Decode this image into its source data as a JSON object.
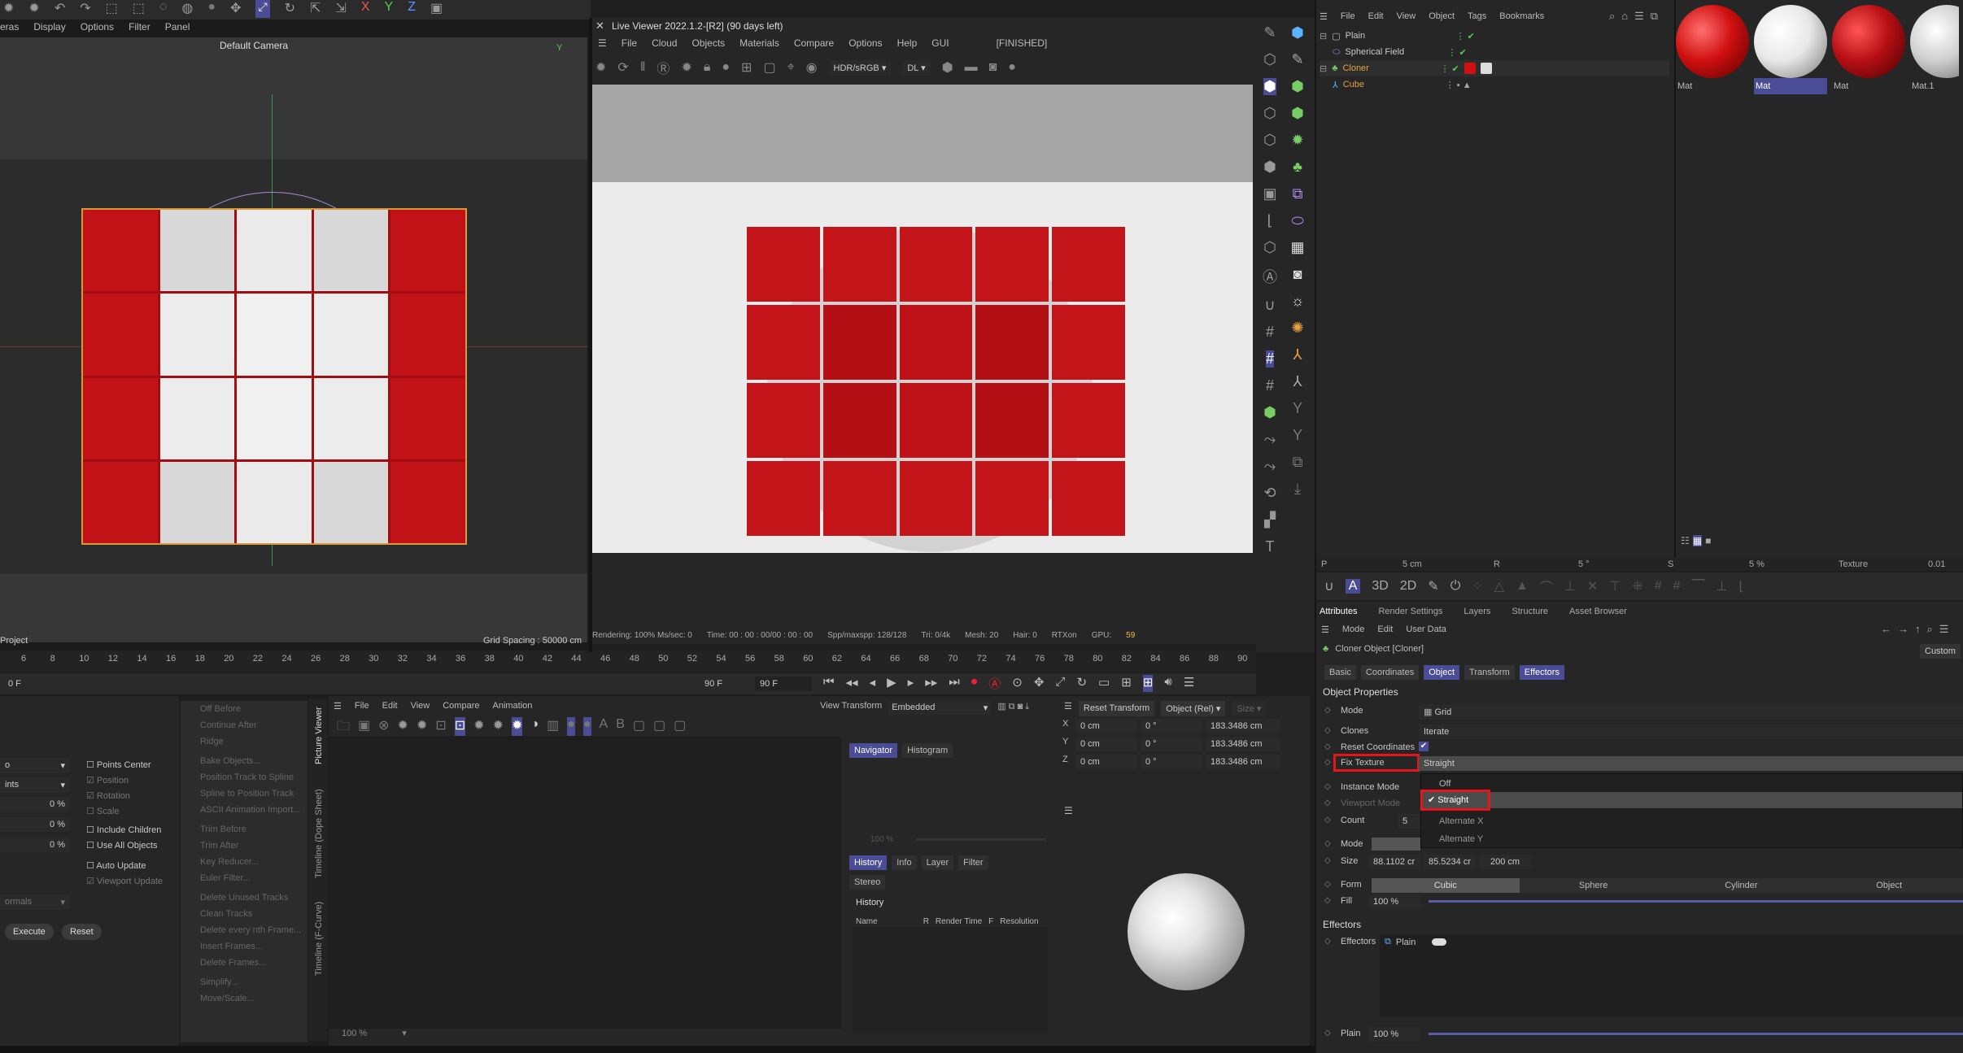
{
  "left_view": {
    "menu": [
      "eras",
      "Display",
      "Options",
      "Filter",
      "Panel"
    ],
    "camera": "Default Camera",
    "project": "Project",
    "grid_spacing": "Grid Spacing : 50000 cm"
  },
  "live_viewer": {
    "title": "Live Viewer 2022.1.2-[R2] (90 days left)",
    "menu": [
      "File",
      "Cloud",
      "Objects",
      "Materials",
      "Compare",
      "Options",
      "Help",
      "GUI"
    ],
    "status": "[FINISHED]",
    "color_mode": "HDR/sRGB",
    "dl": "DL",
    "status_bar": [
      "Rendering: 100% Ms/sec: 0",
      "Time: 00 : 00 : 00/00 : 00 : 00",
      "Spp/maxspp: 128/128",
      "Tri: 0/4k",
      "Mesh: 20",
      "Hair: 0",
      "RTXon",
      "GPU:",
      "59"
    ]
  },
  "timeline": {
    "ticks": [
      "6",
      "8",
      "10",
      "12",
      "14",
      "16",
      "18",
      "20",
      "22",
      "24",
      "26",
      "28",
      "30",
      "32",
      "34",
      "36",
      "38",
      "40",
      "42",
      "44",
      "46",
      "48",
      "50",
      "52",
      "54",
      "56",
      "58",
      "60",
      "62",
      "64",
      "66",
      "68",
      "70",
      "72",
      "74",
      "76",
      "78",
      "80",
      "82",
      "84",
      "86",
      "88",
      "90"
    ],
    "current": "0 F",
    "end": "90 F",
    "end2": "90 F"
  },
  "objects": {
    "menu": [
      "File",
      "Edit",
      "View",
      "Object",
      "Tags",
      "Bookmarks"
    ],
    "items": [
      {
        "name": "Plain",
        "color": "#c8c8c8"
      },
      {
        "name": "Spherical Field",
        "color": "#c8c8c8"
      },
      {
        "name": "Cloner",
        "color": "#e6a23c"
      },
      {
        "name": "Cube",
        "color": "#e6a23c"
      }
    ]
  },
  "materials": [
    {
      "label": "Mat",
      "color": "#d01010"
    },
    {
      "label": "Mat",
      "color": "#e8e8e8"
    },
    {
      "label": "Mat",
      "color": "#b81015"
    },
    {
      "label": "Mat.1",
      "color": "#cfcfcf"
    }
  ],
  "coords_strip": {
    "p": "P",
    "p_val": "5 cm",
    "r": "R",
    "r_val": "5 °",
    "s": "S",
    "s_val": "5 %",
    "texture": "Texture",
    "texture_val": "0.01"
  },
  "attributes": {
    "tabs": [
      "Attributes",
      "Render Settings",
      "Layers",
      "Structure",
      "Asset Browser"
    ],
    "menu": [
      "Mode",
      "Edit",
      "User Data"
    ],
    "title": "Cloner Object [Cloner]",
    "custom": "Custom",
    "subtabs": [
      "Basic",
      "Coordinates",
      "Object",
      "Transform",
      "Effectors"
    ],
    "section": "Object Properties",
    "mode_label": "Mode",
    "mode_val": "Grid",
    "clones_label": "Clones",
    "clones_val": "Iterate",
    "reset_coords_label": "Reset Coordinates",
    "fix_texture_label": "Fix Texture",
    "fix_texture_val": "Straight",
    "instance_mode_label": "Instance Mode",
    "viewport_mode_label": "Viewport Mode",
    "count_label": "Count",
    "count_val": "5",
    "mode2_label": "Mode",
    "size_label": "Size",
    "size_vals": [
      "88.1102 cr",
      "85.5234 cr",
      "200 cm"
    ],
    "form_label": "Form",
    "forms": [
      "Cubic",
      "Sphere",
      "Cylinder",
      "Object"
    ],
    "fill_label": "Fill",
    "fill_val": "100 %",
    "dropdown": [
      "Off",
      "Straight",
      "Alternate X",
      "Alternate Y"
    ],
    "effectors_section": "Effectors",
    "effectors_label": "Effectors",
    "effector_item": "Plain",
    "plain_label": "Plain",
    "plain_val": "100 %"
  },
  "bottom_left": {
    "points_center": "Points Center",
    "position": "Position",
    "rotation": "Rotation",
    "scale": "Scale",
    "pcts": [
      "0 %",
      "0 %",
      "0 %"
    ],
    "include_children": "Include Children",
    "use_all_objects": "Use All Objects",
    "auto_update": "Auto Update",
    "viewport_update": "Viewport Update",
    "execute": "Execute",
    "reset": "Reset",
    "dd1": "o",
    "dd2": "ints",
    "dd3": "ormals"
  },
  "menu_list": [
    "Off Before",
    "Continue After",
    "Ridge",
    "Bake Objects...",
    "Position Track to Spline",
    "Spline to Position Track",
    "ASCII Animation Import...",
    "Trim Before",
    "Trim After",
    "Key Reducer...",
    "Euler Filter...",
    "Delete Unused Tracks",
    "Clean Tracks",
    "Delete every nth Frame...",
    "Insert Frames...",
    "Delete Frames...",
    "Simplify...",
    "Move/Scale..."
  ],
  "side_tabs": [
    "Picture Viewer",
    "Timeline (Dope Sheet)",
    "Timeline (F-Curve)"
  ],
  "picture_viewer": {
    "menu": [
      "File",
      "Edit",
      "View",
      "Compare",
      "Animation"
    ],
    "view_transform": "View Transform",
    "embedded": "Embedded",
    "tabs": [
      "Navigator",
      "Histogram"
    ],
    "zoom": "100 %",
    "tabs2": [
      "History",
      "Info",
      "Layer",
      "Filter"
    ],
    "stereo": "Stereo",
    "history": "History",
    "cols": [
      "Name",
      "R",
      "Render Time",
      "F",
      "Resolution"
    ],
    "zoom2": "100 %"
  },
  "coord_manager": {
    "reset": "Reset Transform",
    "mode": "Object (Rel)",
    "size": "Size",
    "rows": [
      {
        "axis": "X",
        "pos": "0 cm",
        "rot": "0 °",
        "size": "183.3486 cm"
      },
      {
        "axis": "Y",
        "pos": "0 cm",
        "rot": "0 °",
        "size": "183.3486 cm"
      },
      {
        "axis": "Z",
        "pos": "0 cm",
        "rot": "0 °",
        "size": "183.3486 cm"
      }
    ]
  }
}
